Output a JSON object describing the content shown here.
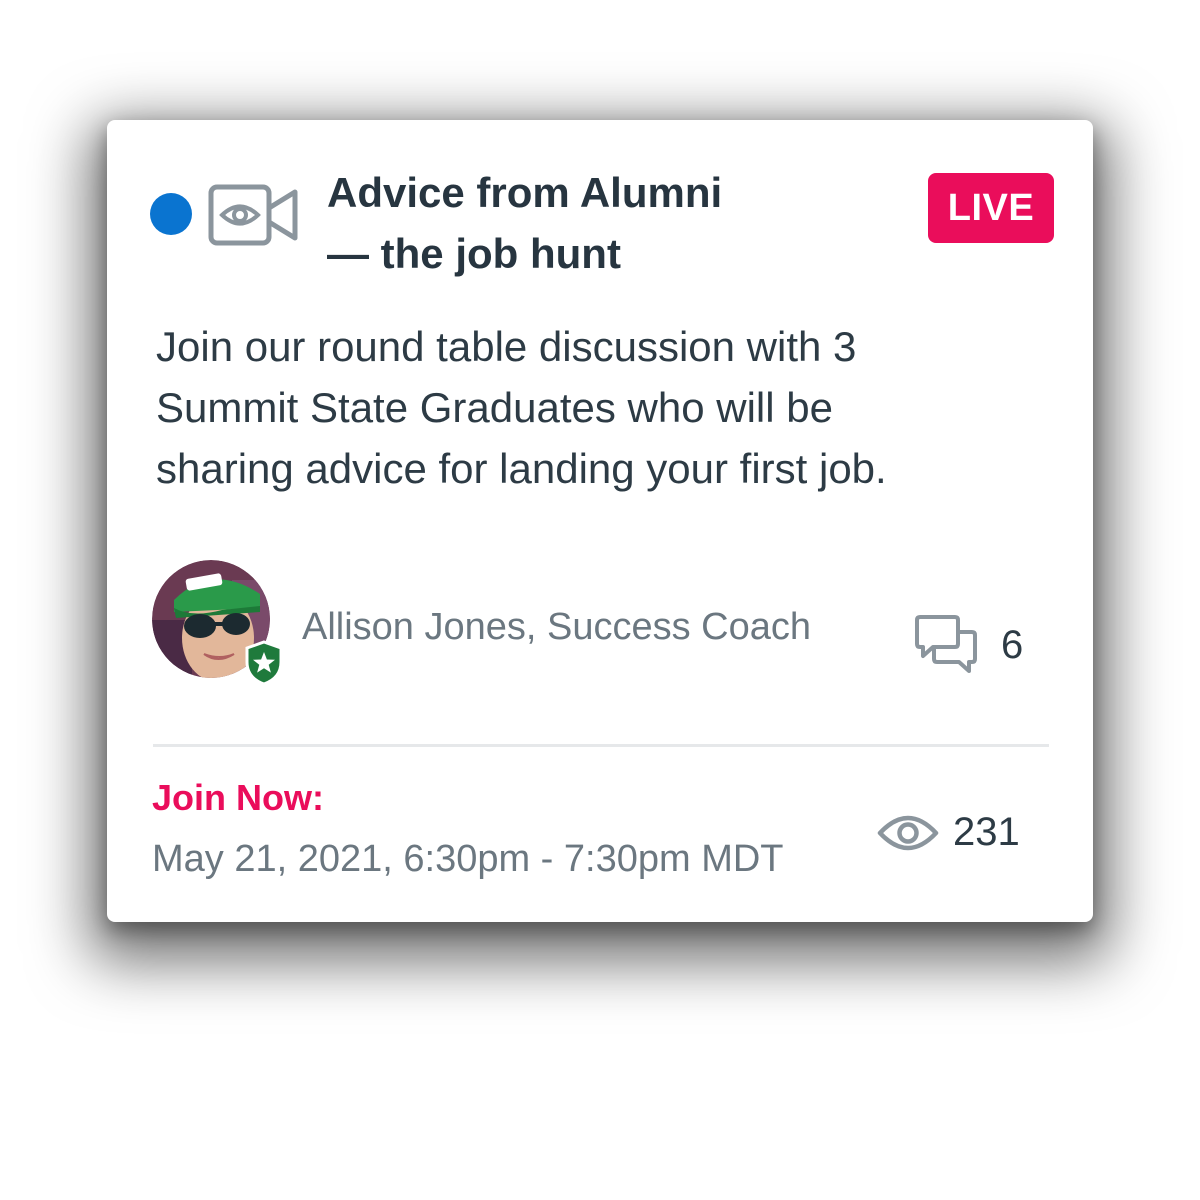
{
  "event": {
    "title_lines": [
      "Advice from Alumni",
      "— the job hunt"
    ],
    "live_label": "LIVE",
    "description_lines": [
      "Join our round table discussion with 3",
      "Summit State Graduates who will be",
      "sharing advice for landing your first job."
    ]
  },
  "host": {
    "name_role": "Allison Jones, Success Coach"
  },
  "stats": {
    "comments": "6",
    "views": "231"
  },
  "footer": {
    "join_label": "Join Now:",
    "schedule": "May 21, 2021, 6:30pm - 7:30pm MDT"
  },
  "icons": {
    "unread": "unread-dot-icon",
    "video": "video-camera-icon",
    "comments": "chat-bubbles-icon",
    "views": "eye-icon",
    "badge": "shield-star-icon"
  },
  "colors": {
    "accent": "#ea0d5b",
    "unread_dot": "#0a74d0",
    "text_primary": "#273540",
    "text_secondary": "#6b7780",
    "badge_green": "#1f7a3c"
  }
}
